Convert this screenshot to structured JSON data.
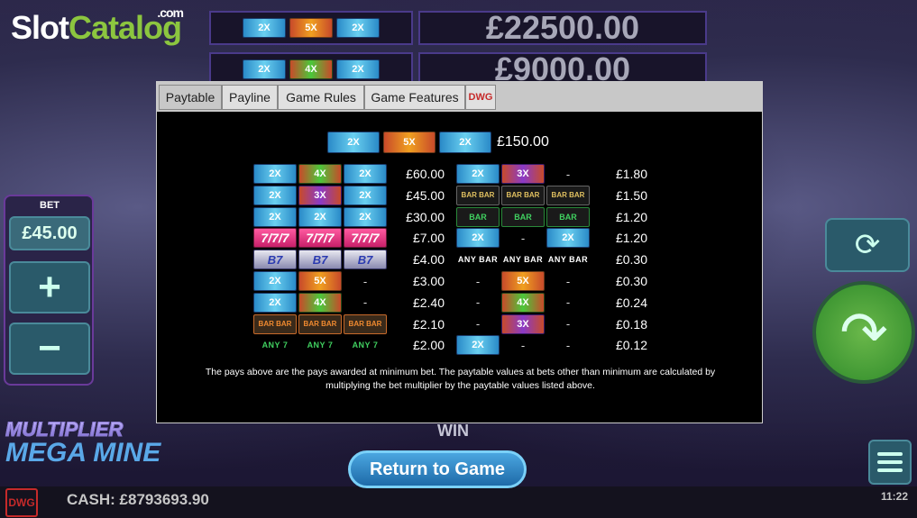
{
  "brand": {
    "slot": "Slot",
    "catalog": "Catalog",
    "com": ".com"
  },
  "banner": {
    "rows": [
      {
        "symbols": [
          "2X",
          "5X",
          "2X"
        ],
        "amount": "£22500.00"
      },
      {
        "symbols": [
          "2X",
          "4X",
          "2X"
        ],
        "amount": "£9000.00"
      }
    ]
  },
  "left_panel": {
    "bet_label": "BET",
    "bet_value": "£45.00",
    "plus": "+",
    "minus": "−"
  },
  "game_logo": {
    "line1": "MULTIPLIER",
    "line2": "MEGA MINE"
  },
  "win_label": "WIN",
  "return_button": "Return to Game",
  "status": {
    "cash": "CASH: £8793693.90",
    "time": "11:22",
    "provider_logo": "DWG"
  },
  "modal": {
    "tabs": [
      "Paytable",
      "Payline",
      "Game Rules",
      "Game Features"
    ],
    "active_tab": "Paytable",
    "provider_tab_icon": "DWG",
    "top_combo": {
      "symbols": [
        "2X",
        "5X",
        "2X"
      ],
      "prize": "£150.00"
    },
    "left_table": [
      {
        "symbols": [
          "2X",
          "4X",
          "2X"
        ],
        "prize": "£60.00"
      },
      {
        "symbols": [
          "2X",
          "3X",
          "2X"
        ],
        "prize": "£45.00"
      },
      {
        "symbols": [
          "2X",
          "2X",
          "2X"
        ],
        "prize": "£30.00"
      },
      {
        "symbols": [
          "777",
          "777",
          "777"
        ],
        "prize": "£7.00"
      },
      {
        "symbols": [
          "B7",
          "B7",
          "B7"
        ],
        "prize": "£4.00"
      },
      {
        "symbols": [
          "2X",
          "5X",
          "-"
        ],
        "prize": "£3.00"
      },
      {
        "symbols": [
          "2X",
          "4X",
          "-"
        ],
        "prize": "£2.40"
      },
      {
        "symbols": [
          "BAR3",
          "BAR3",
          "BAR3"
        ],
        "prize": "£2.10"
      },
      {
        "symbols": [
          "ANY 7",
          "ANY 7",
          "ANY 7"
        ],
        "prize": "£2.00"
      }
    ],
    "right_table": [
      {
        "symbols": [
          "2X",
          "3X",
          "-"
        ],
        "prize": "£1.80"
      },
      {
        "symbols": [
          "BAR2",
          "BAR2",
          "BAR2"
        ],
        "prize": "£1.50"
      },
      {
        "symbols": [
          "BAR",
          "BAR",
          "BAR"
        ],
        "prize": "£1.20"
      },
      {
        "symbols": [
          "2X",
          "-",
          "2X"
        ],
        "prize": "£1.20"
      },
      {
        "symbols": [
          "ANY BAR",
          "ANY BAR",
          "ANY BAR"
        ],
        "prize": "£0.30"
      },
      {
        "symbols": [
          "-",
          "5X",
          "-"
        ],
        "prize": "£0.30"
      },
      {
        "symbols": [
          "-",
          "4X",
          "-"
        ],
        "prize": "£0.24"
      },
      {
        "symbols": [
          "-",
          "3X",
          "-"
        ],
        "prize": "£0.18"
      },
      {
        "symbols": [
          "2X",
          "-",
          "-"
        ],
        "prize": "£0.12"
      }
    ],
    "note": "The pays above are the pays awarded at minimum bet. The paytable values at bets other than minimum are calculated by multiplying the bet multiplier by the paytable values listed above."
  }
}
